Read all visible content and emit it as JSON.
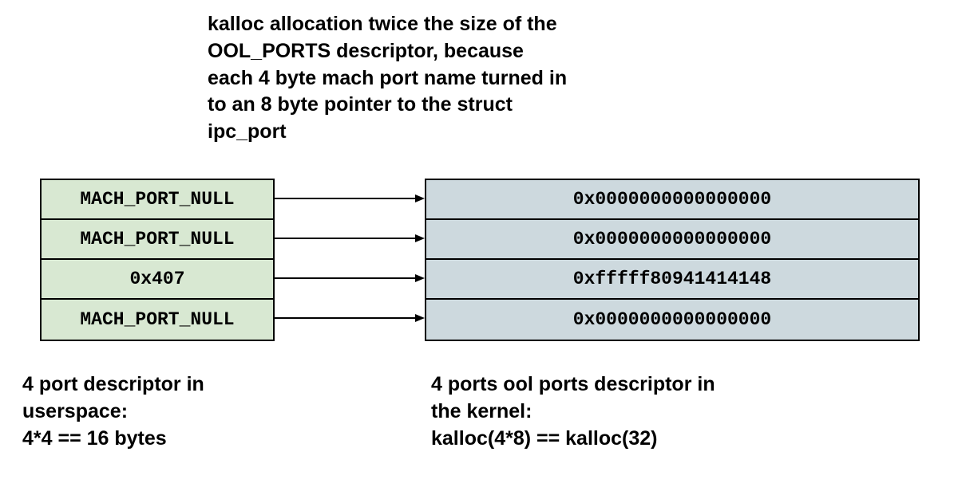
{
  "header": {
    "line1": "kalloc allocation twice the size of the",
    "line2": "OOL_PORTS descriptor, because",
    "line3": "each 4 byte mach port name turned in",
    "line4": "to an 8 byte pointer to the struct",
    "line5": "ipc_port"
  },
  "left_table": {
    "rows": [
      {
        "label": "MACH_PORT_NULL"
      },
      {
        "label": "MACH_PORT_NULL"
      },
      {
        "label": "0x407"
      },
      {
        "label": "MACH_PORT_NULL"
      }
    ]
  },
  "right_table": {
    "rows": [
      {
        "label": "0x0000000000000000"
      },
      {
        "label": "0x0000000000000000"
      },
      {
        "label": "0xfffff80941414148"
      },
      {
        "label": "0x0000000000000000"
      }
    ]
  },
  "caption_left": {
    "line1": "4 port descriptor in",
    "line2": "userspace:",
    "line3": "4*4 == 16 bytes"
  },
  "caption_right": {
    "line1": "4 ports ool ports descriptor in",
    "line2": "the kernel:",
    "line3": "kalloc(4*8) == kalloc(32)"
  }
}
